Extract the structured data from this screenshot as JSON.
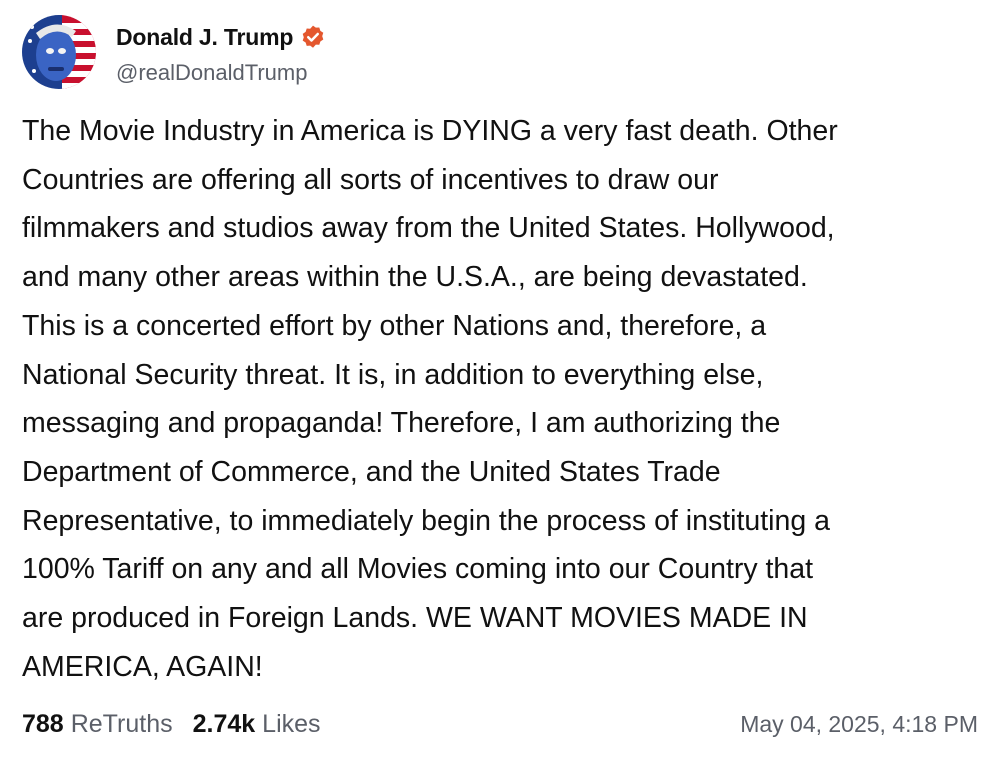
{
  "author": {
    "display_name": "Donald J. Trump",
    "handle": "@realDonaldTrump",
    "verified": true,
    "verified_badge_color": "#e4572e"
  },
  "post": {
    "lines": [
      "The Movie Industry in America is DYING a very fast death. Other",
      "Countries are offering all sorts of incentives to draw our",
      "filmmakers and studios away from the United States. Hollywood,",
      "and many other areas within the U.S.A., are being devastated.",
      "This is a concerted effort by other Nations and, therefore, a",
      "National Security threat. It is, in addition to everything else,",
      "messaging and propaganda! Therefore, I am authorizing the",
      "Department of Commerce, and the United States Trade",
      "Representative, to immediately begin the process of instituting a",
      "100% Tariff on any and all Movies coming into our Country that",
      "are produced in Foreign Lands. WE WANT MOVIES MADE IN",
      "AMERICA, AGAIN!"
    ]
  },
  "stats": {
    "retruths_count": "788",
    "retruths_label": "ReTruths",
    "likes_count": "2.74k",
    "likes_label": "Likes"
  },
  "timestamp": "May 04, 2025, 4:18 PM"
}
